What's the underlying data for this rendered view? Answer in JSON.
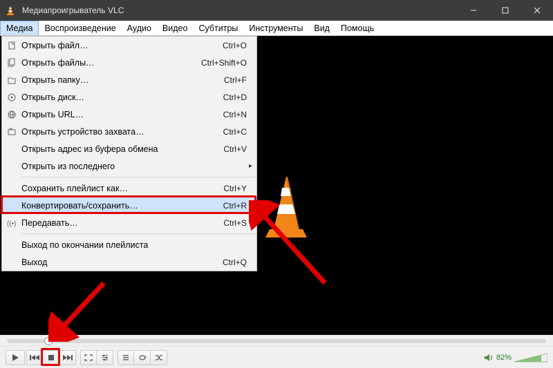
{
  "title": "Медиапроигрыватель VLC",
  "menubar": [
    "Медиа",
    "Воспроизведение",
    "Аудио",
    "Видео",
    "Субтитры",
    "Инструменты",
    "Вид",
    "Помощь"
  ],
  "active_menu_index": 0,
  "dropdown": {
    "items": [
      {
        "icon": "file-icon",
        "label": "Открыть файл…",
        "shortcut": "Ctrl+O"
      },
      {
        "icon": "files-icon",
        "label": "Открыть файлы…",
        "shortcut": "Ctrl+Shift+O"
      },
      {
        "icon": "folder-icon",
        "label": "Открыть папку…",
        "shortcut": "Ctrl+F"
      },
      {
        "icon": "disc-icon",
        "label": "Открыть диск…",
        "shortcut": "Ctrl+D"
      },
      {
        "icon": "network-icon",
        "label": "Открыть URL…",
        "shortcut": "Ctrl+N"
      },
      {
        "icon": "capture-icon",
        "label": "Открыть устройство захвата…",
        "shortcut": "Ctrl+C"
      },
      {
        "icon": "",
        "label": "Открыть адрес из буфера обмена",
        "shortcut": "Ctrl+V"
      },
      {
        "icon": "",
        "label": "Открыть из последнего",
        "shortcut": "",
        "submenu": true
      },
      {
        "sep": true
      },
      {
        "icon": "",
        "label": "Сохранить плейлист как…",
        "shortcut": "Ctrl+Y"
      },
      {
        "icon": "",
        "label": "Конвертировать/сохранить…",
        "shortcut": "Ctrl+R",
        "highlight": true
      },
      {
        "icon": "stream-icon",
        "label": "Передавать…",
        "shortcut": "Ctrl+S"
      },
      {
        "sep": true
      },
      {
        "icon": "",
        "label": "Выход по окончании плейлиста",
        "shortcut": ""
      },
      {
        "icon": "",
        "label": "Выход",
        "shortcut": "Ctrl+Q"
      }
    ]
  },
  "volume_percent": "82%",
  "controls": {
    "play": "play-icon",
    "prev": "prev-icon",
    "stop": "stop-icon",
    "next": "next-icon",
    "fullscreen": "fullscreen-icon",
    "extended": "extended-settings-icon",
    "playlist": "playlist-icon",
    "loop": "loop-icon",
    "shuffle": "shuffle-icon"
  }
}
